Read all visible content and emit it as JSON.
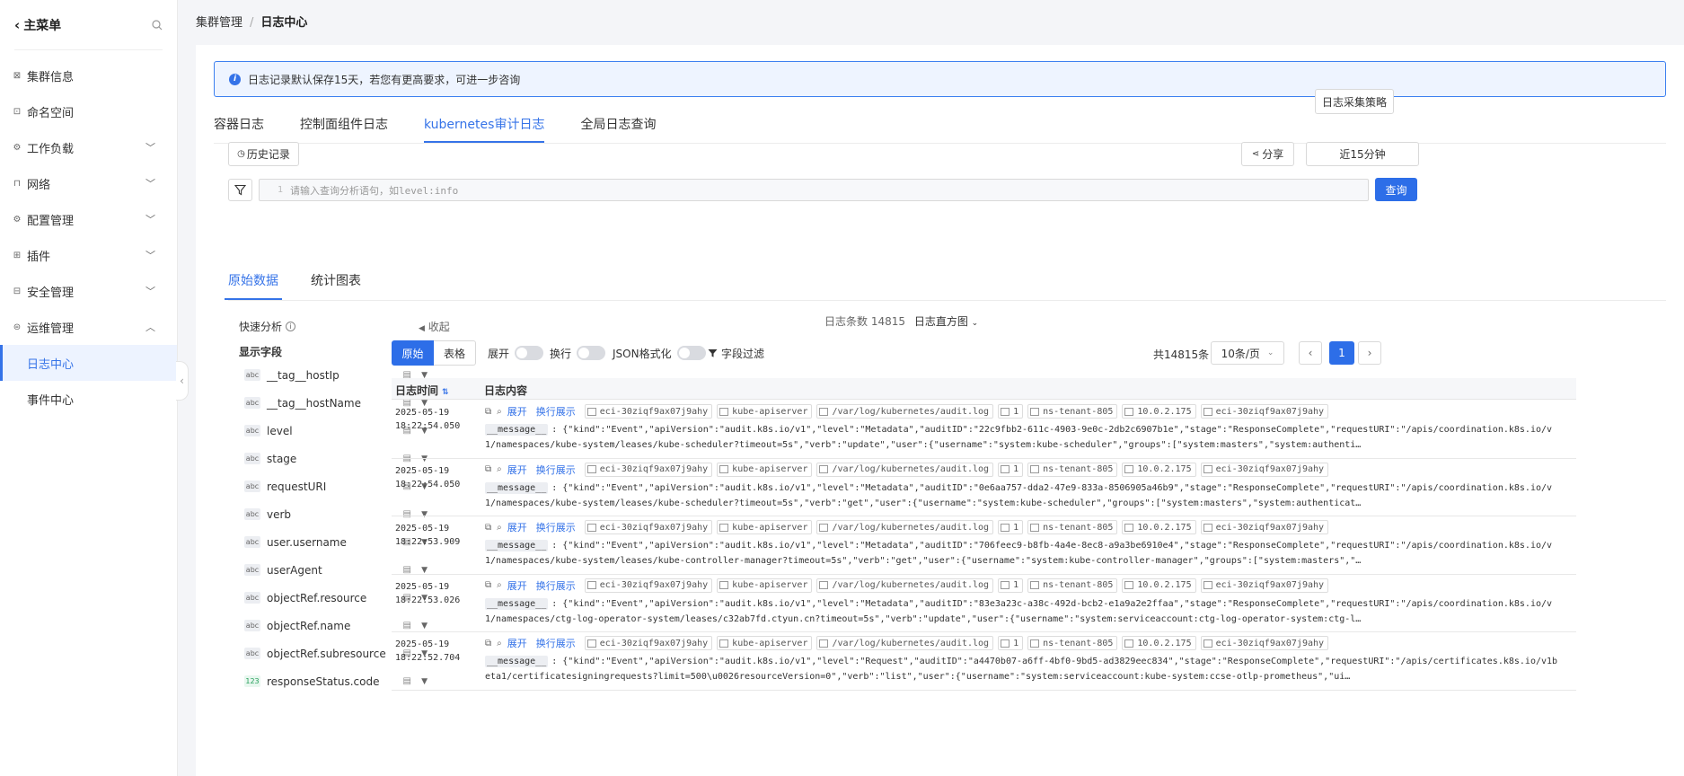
{
  "sidebar": {
    "back_label": "主菜单",
    "items": [
      {
        "label": "集群信息",
        "icon": "cluster-icon",
        "has_caret": false
      },
      {
        "label": "命名空间",
        "icon": "namespace-icon",
        "has_caret": false
      },
      {
        "label": "工作负载",
        "icon": "workload-icon",
        "has_caret": true
      },
      {
        "label": "网络",
        "icon": "network-icon",
        "has_caret": true
      },
      {
        "label": "配置管理",
        "icon": "config-icon",
        "has_caret": true
      },
      {
        "label": "插件",
        "icon": "plugin-icon",
        "has_caret": true
      },
      {
        "label": "安全管理",
        "icon": "security-icon",
        "has_caret": true
      },
      {
        "label": "运维管理",
        "icon": "ops-icon",
        "has_caret": true,
        "expanded": true
      }
    ],
    "sub_items": [
      "日志中心",
      "事件中心"
    ]
  },
  "breadcrumb": {
    "parent": "集群管理",
    "separator": "/",
    "current": "日志中心"
  },
  "notice": {
    "text": "日志记录默认保存15天，若您有更高要求，可进一步咨询"
  },
  "tabs": [
    "容器日志",
    "控制面组件日志",
    "kubernetes审计日志",
    "全局日志查询"
  ],
  "active_tab": 2,
  "collect_policy_button": "日志采集策略",
  "history_button": "历史记录",
  "share_button": "分享",
  "time_range": "近15分钟",
  "query": {
    "line": "1",
    "placeholder": "请输入查询分析语句，如level:info",
    "button": "查询"
  },
  "subtabs": [
    "原始数据",
    "统计图表"
  ],
  "quick_analysis": {
    "title": "快速分析",
    "collapse": "收起",
    "show_fields": "显示字段",
    "fields": [
      {
        "type": "abc",
        "name": "__tag__hostIp"
      },
      {
        "type": "abc",
        "name": "__tag__hostName"
      },
      {
        "type": "abc",
        "name": "level"
      },
      {
        "type": "abc",
        "name": "stage"
      },
      {
        "type": "abc",
        "name": "requestURI"
      },
      {
        "type": "abc",
        "name": "verb"
      },
      {
        "type": "abc",
        "name": "user.username"
      },
      {
        "type": "abc",
        "name": "userAgent"
      },
      {
        "type": "abc",
        "name": "objectRef.resource"
      },
      {
        "type": "abc",
        "name": "objectRef.name"
      },
      {
        "type": "abc",
        "name": "objectRef.subresource"
      },
      {
        "type": "123",
        "name": "responseStatus.code"
      }
    ]
  },
  "summary": {
    "count_text": "日志条数 14815",
    "histogram": "日志直方图"
  },
  "toolbar": {
    "raw": "原始",
    "table": "表格",
    "expand": "展开",
    "wrap": "换行",
    "json": "JSON格式化",
    "field_filter": "字段过滤",
    "total": "共14815条",
    "page_size": "10条/页",
    "page": "1"
  },
  "table": {
    "col_time": "日志时间",
    "col_content": "日志内容",
    "row_links": {
      "expand": "展开",
      "wrap": "换行展示"
    },
    "message_key": "__message__",
    "rows": [
      {
        "date": "2025-05-19",
        "time": "18:22:54.050",
        "tags": [
          "eci-30ziqf9ax07j9ahy",
          "kube-apiserver",
          "/var/log/kubernetes/audit.log",
          "1",
          "ns-tenant-805",
          "10.0.2.175",
          "eci-30ziqf9ax07j9ahy"
        ],
        "message": ": {\"kind\":\"Event\",\"apiVersion\":\"audit.k8s.io/v1\",\"level\":\"Metadata\",\"auditID\":\"22c9fbb2-611c-4903-9e0c-2db2c6907b1e\",\"stage\":\"ResponseComplete\",\"requestURI\":\"/apis/coordination.k8s.io/v1/namespaces/kube-system/leases/kube-scheduler?timeout=5s\",\"verb\":\"update\",\"user\":{\"username\":\"system:kube-scheduler\",\"groups\":[\"system:masters\",\"system:authenti…"
      },
      {
        "date": "2025-05-19",
        "time": "18:22:54.050",
        "tags": [
          "eci-30ziqf9ax07j9ahy",
          "kube-apiserver",
          "/var/log/kubernetes/audit.log",
          "1",
          "ns-tenant-805",
          "10.0.2.175",
          "eci-30ziqf9ax07j9ahy"
        ],
        "message": ": {\"kind\":\"Event\",\"apiVersion\":\"audit.k8s.io/v1\",\"level\":\"Metadata\",\"auditID\":\"0e6aa757-dda2-47e9-833a-8506905a46b9\",\"stage\":\"ResponseComplete\",\"requestURI\":\"/apis/coordination.k8s.io/v1/namespaces/kube-system/leases/kube-scheduler?timeout=5s\",\"verb\":\"get\",\"user\":{\"username\":\"system:kube-scheduler\",\"groups\":[\"system:masters\",\"system:authenticat…"
      },
      {
        "date": "2025-05-19",
        "time": "18:22:53.909",
        "tags": [
          "eci-30ziqf9ax07j9ahy",
          "kube-apiserver",
          "/var/log/kubernetes/audit.log",
          "1",
          "ns-tenant-805",
          "10.0.2.175",
          "eci-30ziqf9ax07j9ahy"
        ],
        "message": ": {\"kind\":\"Event\",\"apiVersion\":\"audit.k8s.io/v1\",\"level\":\"Metadata\",\"auditID\":\"706feec9-b8fb-4a4e-8ec8-a9a3be6910e4\",\"stage\":\"ResponseComplete\",\"requestURI\":\"/apis/coordination.k8s.io/v1/namespaces/kube-system/leases/kube-controller-manager?timeout=5s\",\"verb\":\"get\",\"user\":{\"username\":\"system:kube-controller-manager\",\"groups\":[\"system:masters\",\"…"
      },
      {
        "date": "2025-05-19",
        "time": "18:22:53.026",
        "tags": [
          "eci-30ziqf9ax07j9ahy",
          "kube-apiserver",
          "/var/log/kubernetes/audit.log",
          "1",
          "ns-tenant-805",
          "10.0.2.175",
          "eci-30ziqf9ax07j9ahy"
        ],
        "message": ": {\"kind\":\"Event\",\"apiVersion\":\"audit.k8s.io/v1\",\"level\":\"Metadata\",\"auditID\":\"83e3a23c-a38c-492d-bcb2-e1a9a2e2ffaa\",\"stage\":\"ResponseComplete\",\"requestURI\":\"/apis/coordination.k8s.io/v1/namespaces/ctg-log-operator-system/leases/c32ab7fd.ctyun.cn?timeout=5s\",\"verb\":\"update\",\"user\":{\"username\":\"system:serviceaccount:ctg-log-operator-system:ctg-l…"
      },
      {
        "date": "2025-05-19",
        "time": "18:22:52.704",
        "tags": [
          "eci-30ziqf9ax07j9ahy",
          "kube-apiserver",
          "/var/log/kubernetes/audit.log",
          "1",
          "ns-tenant-805",
          "10.0.2.175",
          "eci-30ziqf9ax07j9ahy"
        ],
        "message": ": {\"kind\":\"Event\",\"apiVersion\":\"audit.k8s.io/v1\",\"level\":\"Request\",\"auditID\":\"a4470b07-a6ff-4bf0-9bd5-ad3829eec834\",\"stage\":\"ResponseComplete\",\"requestURI\":\"/apis/certificates.k8s.io/v1beta1/certificatesigningrequests?limit=500\\u0026resourceVersion=0\",\"verb\":\"list\",\"user\":{\"username\":\"system:serviceaccount:kube-system:ccse-otlp-prometheus\",\"ui…"
      }
    ]
  },
  "colors": {
    "accent": "#2d6ee8",
    "active_bg": "#edf3ff",
    "page_bg": "#f4f5f8"
  }
}
